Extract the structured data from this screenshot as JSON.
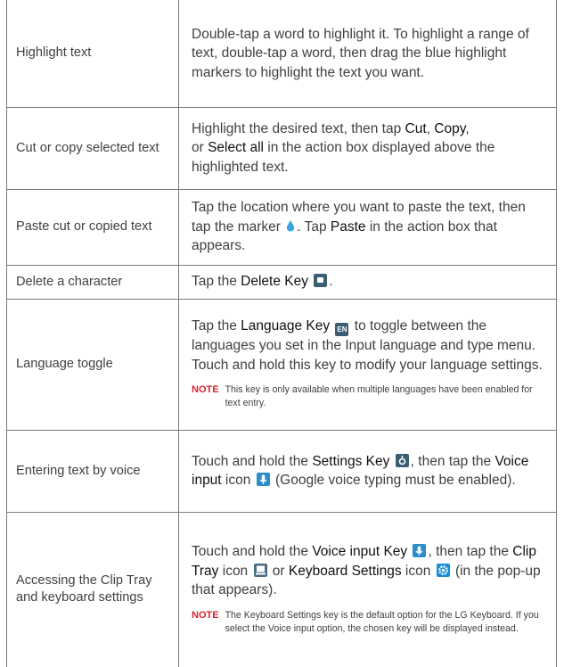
{
  "rows": [
    {
      "label": "Highlight text",
      "desc": "Double-tap a word to highlight it. To highlight a range of text, double-tap a word, then drag the blue highlight markers to highlight the text you want."
    },
    {
      "label": "Cut or copy selected text",
      "desc_pre": "Highlight the desired text, then tap ",
      "cut": "Cut",
      "comma": ", ",
      "copy": "Copy",
      "comma2": ",",
      "or": " or ",
      "select_all": "Select all",
      "desc_post": " in the action box displayed above the highlighted text."
    },
    {
      "label": "Paste cut or copied text",
      "desc_pre": "Tap the location where you want to paste the text, then tap the marker ",
      "desc_mid": ". Tap ",
      "paste": "Paste",
      "desc_post": " in the action box that appears."
    },
    {
      "label": "Delete a character",
      "desc_pre": "Tap the ",
      "key": "Delete Key",
      "desc_post": "."
    },
    {
      "label": "Language toggle",
      "desc_pre": "Tap the ",
      "key": "Language Key",
      "key_icon_text": "EN",
      "desc_post": " to toggle between the languages you set in the Input language and type menu. Touch and hold this key to modify your language settings.",
      "note_tag": "NOTE",
      "note": "This key is only available when multiple languages have been enabled for text entry."
    },
    {
      "label": "Entering text by voice",
      "desc_pre": "Touch and hold the ",
      "key": "Settings Key",
      "desc_mid": ", then tap the ",
      "voice": "Voice input",
      "desc_mid2": " icon ",
      "desc_post": " (Google voice typing must be enabled)."
    },
    {
      "label": "Accessing the Clip Tray and keyboard settings",
      "desc_pre": "Touch and hold the ",
      "key": "Voice input Key",
      "desc_mid": ", then tap the ",
      "clip": "Clip Tray",
      "desc_mid2": " icon ",
      "or": " or ",
      "kb": "Keyboard Settings",
      "desc_mid3": " icon ",
      "desc_post": " (in the pop-up that appears).",
      "note_tag": "NOTE",
      "note": "The Keyboard Settings key is the default option for the LG Keyboard. If you select the Voice input option, the chosen key will be displayed instead."
    }
  ],
  "colors": {
    "note": "#d9232e",
    "icon_dark": "#3c5e72",
    "icon_blue": "#1b8fd6",
    "marker": "#3aa6e0"
  },
  "icons": [
    "marker-icon",
    "delete-key-icon",
    "language-key-icon",
    "settings-key-icon",
    "voice-input-icon",
    "clip-tray-icon",
    "keyboard-settings-icon"
  ]
}
